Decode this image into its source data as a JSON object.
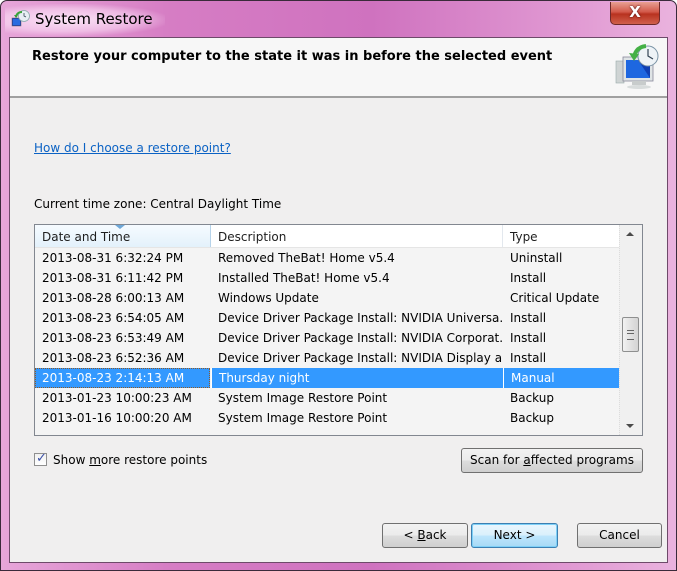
{
  "window": {
    "title": "System Restore",
    "close_label": "X"
  },
  "header": {
    "title": "Restore your computer to the state it was in before the selected event"
  },
  "help_link": "How do I choose a restore point?",
  "timezone_label": "Current time zone: Central Daylight Time",
  "table": {
    "columns": [
      "Date and Time",
      "Description",
      "Type"
    ],
    "sorted_column": "Date and Time",
    "rows": [
      {
        "date": "2013-08-31 6:32:24 PM",
        "description": "Removed TheBat! Home v5.4",
        "type": "Uninstall",
        "selected": false
      },
      {
        "date": "2013-08-31 6:11:42 PM",
        "description": "Installed TheBat! Home v5.4",
        "type": "Install",
        "selected": false
      },
      {
        "date": "2013-08-28 6:00:13 AM",
        "description": "Windows Update",
        "type": "Critical Update",
        "selected": false
      },
      {
        "date": "2013-08-23 6:54:05 AM",
        "description": "Device Driver Package Install: NVIDIA Universa...",
        "type": "Install",
        "selected": false
      },
      {
        "date": "2013-08-23 6:53:49 AM",
        "description": "Device Driver Package Install: NVIDIA Corporat...",
        "type": "Install",
        "selected": false
      },
      {
        "date": "2013-08-23 6:52:36 AM",
        "description": "Device Driver Package Install: NVIDIA Display a...",
        "type": "Install",
        "selected": false
      },
      {
        "date": "2013-08-23 2:14:13 AM",
        "description": "Thursday night",
        "type": "Manual",
        "selected": true
      },
      {
        "date": "2013-01-23 10:00:23 AM",
        "description": "System Image Restore Point",
        "type": "Backup",
        "selected": false
      },
      {
        "date": "2013-01-16 10:00:20 AM",
        "description": "System Image Restore Point",
        "type": "Backup",
        "selected": false
      }
    ]
  },
  "show_more": {
    "checked": true,
    "label_pre": "Show ",
    "label_accel": "m",
    "label_post": "ore restore points"
  },
  "buttons": {
    "scan": {
      "pre": "Scan for ",
      "accel": "a",
      "post": "ffected programs"
    },
    "back": {
      "pre": "< ",
      "accel": "B",
      "post": "ack"
    },
    "next": "Next >",
    "cancel": "Cancel"
  },
  "colors": {
    "selection": "#3399ff",
    "link": "#0b62c4",
    "frame": "#d67dc4"
  }
}
